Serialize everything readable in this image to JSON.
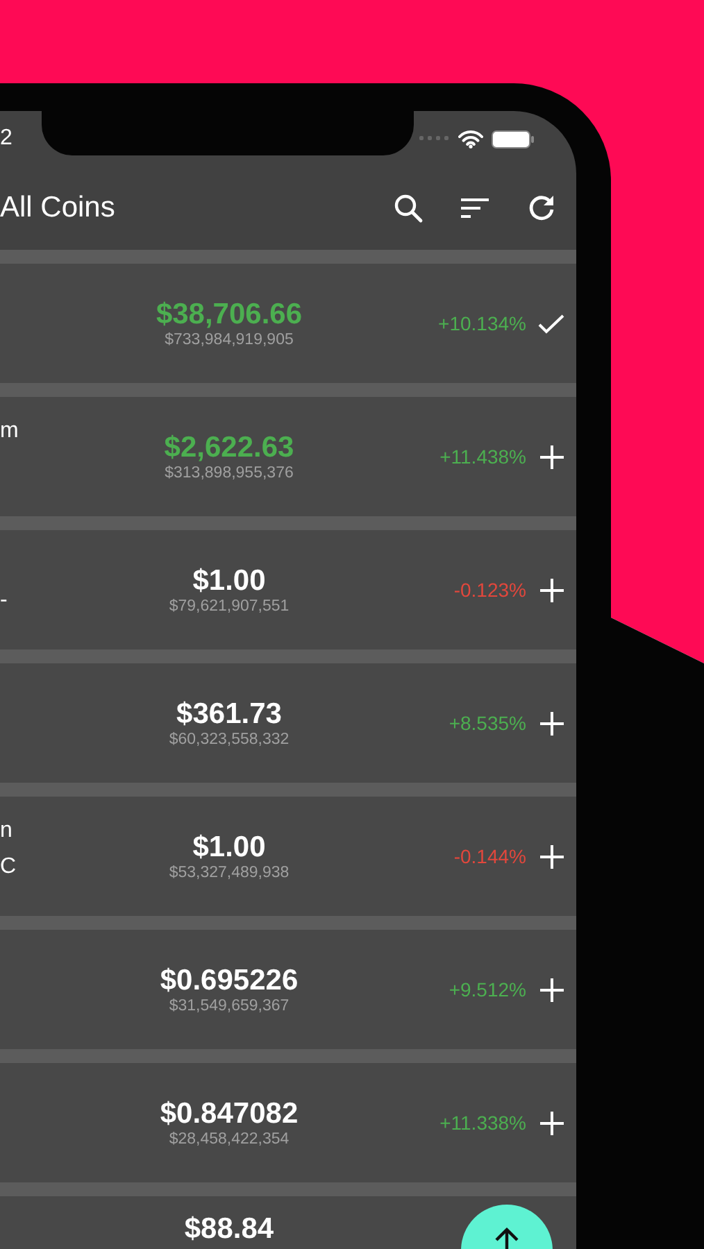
{
  "status_bar": {
    "time": "2"
  },
  "app_bar": {
    "title": "All Coins"
  },
  "coins": [
    {
      "price": "$38,706.66",
      "market_cap": "$733,984,919,905",
      "change": "+10.134%",
      "color": "#4caf50",
      "price_flash": true,
      "in_watchlist": true
    },
    {
      "name": "m",
      "price": "$2,622.63",
      "market_cap": "$313,898,955,376",
      "change": "+11.438%",
      "color": "#4caf50",
      "price_flash": true,
      "in_watchlist": false
    },
    {
      "symbol": "-",
      "price": "$1.00",
      "market_cap": "$79,621,907,551",
      "change": "-0.123%",
      "color": "#e2473c",
      "price_flash": false,
      "in_watchlist": false
    },
    {
      "price": "$361.73",
      "market_cap": "$60,323,558,332",
      "change": "+8.535%",
      "color": "#4caf50",
      "price_flash": false,
      "in_watchlist": false
    },
    {
      "name": "n",
      "symbol": "C",
      "price": "$1.00",
      "market_cap": "$53,327,489,938",
      "change": "-0.144%",
      "color": "#e2473c",
      "price_flash": false,
      "in_watchlist": false
    },
    {
      "price": "$0.695226",
      "market_cap": "$31,549,659,367",
      "change": "+9.512%",
      "color": "#4caf50",
      "price_flash": false,
      "in_watchlist": false
    },
    {
      "price": "$0.847082",
      "market_cap": "$28,458,422,354",
      "change": "+11.338%",
      "color": "#4caf50",
      "price_flash": false,
      "in_watchlist": false
    }
  ],
  "partial_row": {
    "price": "$88.84"
  }
}
